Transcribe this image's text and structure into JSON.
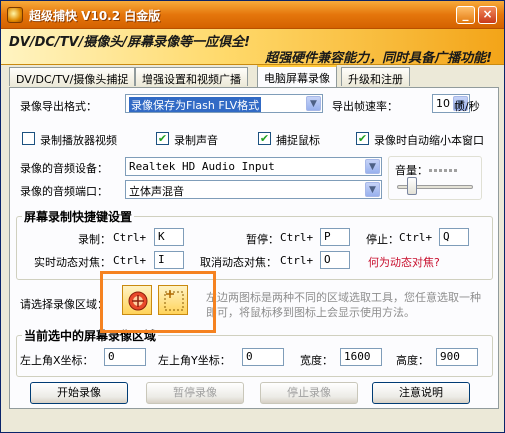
{
  "window": {
    "title": "超级捕快 V10.2 白金版",
    "banner_line1": "DV/DC/TV/摄像头/屏幕录像等一应俱全!",
    "banner_line2": "超强硬件兼容能力，同时具备广播功能!",
    "minimize_glyph": "_",
    "close_glyph": "×"
  },
  "tabs": [
    {
      "label": "DV/DC/TV/摄像头捕捉"
    },
    {
      "label": "增强设置和视频广播"
    },
    {
      "label": "电脑屏幕录像"
    },
    {
      "label": "升级和注册"
    }
  ],
  "export": {
    "format_label": "录像导出格式：",
    "format_value": "录像保存为Flash FLV格式",
    "fps_label": "导出帧速率：",
    "fps_value": "10",
    "fps_unit": "帧/秒"
  },
  "options": [
    {
      "label": "录制播放器视频",
      "checked": false
    },
    {
      "label": "录制声音",
      "checked": true
    },
    {
      "label": "捕捉鼠标",
      "checked": true
    },
    {
      "label": "录像时自动缩小本窗口",
      "checked": true
    }
  ],
  "audio": {
    "device_label": "录像的音频设备：",
    "device_value": "Realtek HD Audio Input",
    "port_label": "录像的音频端口：",
    "port_value": "立体声混音",
    "volume_label": "音量：",
    "volume_level": 0.15
  },
  "hotkeys": {
    "title": "屏幕录制快捷键设置",
    "record_label": "录制：",
    "record_mod": "Ctrl+",
    "record_key": "K",
    "pause_label": "暂停：",
    "pause_mod": "Ctrl+",
    "pause_key": "P",
    "stop_label": "停止：",
    "stop_mod": "Ctrl+",
    "stop_key": "Q",
    "follow_label": "实时动态对焦：",
    "follow_mod": "Ctrl+",
    "follow_key": "I",
    "cancel_label": "取消动态对焦：",
    "cancel_mod": "Ctrl+",
    "cancel_key": "O",
    "help_link": "何为动态对焦?"
  },
  "region": {
    "label": "请选择录像区域：",
    "hint": "左边两图标是两种不同的区域选取工具，您任意选取一种即可，将鼠标移到图标上会显示使用方法。"
  },
  "current_region": {
    "title": "当前选中的屏幕录像区域",
    "x_label": "左上角X坐标：",
    "x_value": "0",
    "y_label": "左上角Y坐标：",
    "y_value": "0",
    "width_label": "宽度：",
    "width_value": "1600",
    "height_label": "高度：",
    "height_value": "900"
  },
  "buttons": {
    "start": "开始录像",
    "pause": "暂停录像",
    "stop": "停止录像",
    "notes": "注意说明"
  },
  "colors": {
    "title_bar": "#e5760c",
    "highlight": "#316ac5",
    "link": "#c8102e",
    "frame": "#f58220"
  }
}
